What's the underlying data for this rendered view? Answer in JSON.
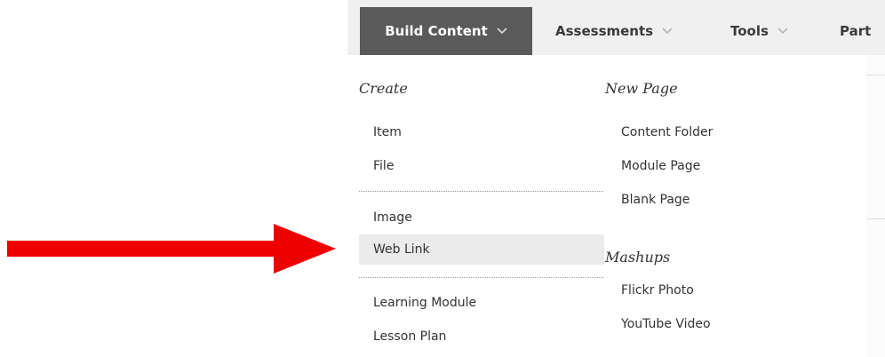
{
  "menubar": {
    "tabs": [
      {
        "label": "Build Content"
      },
      {
        "label": "Assessments"
      },
      {
        "label": "Tools"
      },
      {
        "label": "Part"
      }
    ]
  },
  "dropdown": {
    "create": {
      "heading": "Create",
      "items": [
        "Item",
        "File",
        "Image",
        "Web Link",
        "Learning Module",
        "Lesson Plan"
      ]
    },
    "new_page": {
      "heading": "New Page",
      "items": [
        "Content Folder",
        "Module Page",
        "Blank Page"
      ]
    },
    "mashups": {
      "heading": "Mashups",
      "items": [
        "Flickr Photo",
        "YouTube Video"
      ]
    }
  },
  "highlighted_item": "Web Link",
  "colors": {
    "arrow": "#ee0000",
    "active_tab": "#5a5a5a",
    "menubar": "#f0f0f0",
    "highlight": "#ebebeb"
  },
  "icons": [
    "arrow-right-icon",
    "chevron-down-icon"
  ]
}
